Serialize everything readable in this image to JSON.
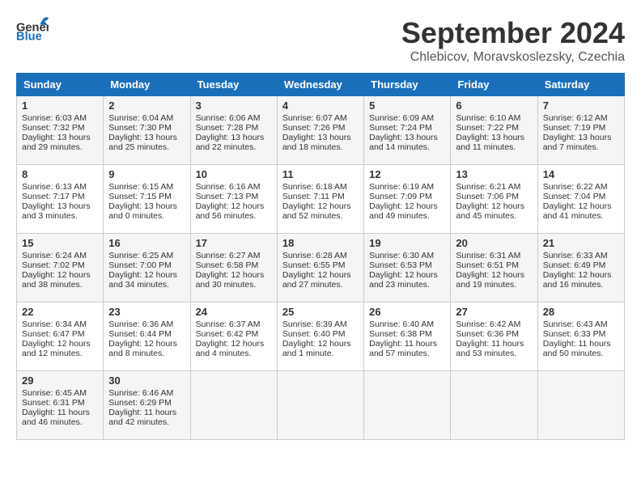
{
  "header": {
    "logo_general": "General",
    "logo_blue": "Blue",
    "month_title": "September 2024",
    "subtitle": "Chlebicov, Moravskoslezsky, Czechia"
  },
  "days_of_week": [
    "Sunday",
    "Monday",
    "Tuesday",
    "Wednesday",
    "Thursday",
    "Friday",
    "Saturday"
  ],
  "weeks": [
    [
      {
        "day": "1",
        "info": "Sunrise: 6:03 AM\nSunset: 7:32 PM\nDaylight: 13 hours\nand 29 minutes."
      },
      {
        "day": "2",
        "info": "Sunrise: 6:04 AM\nSunset: 7:30 PM\nDaylight: 13 hours\nand 25 minutes."
      },
      {
        "day": "3",
        "info": "Sunrise: 6:06 AM\nSunset: 7:28 PM\nDaylight: 13 hours\nand 22 minutes."
      },
      {
        "day": "4",
        "info": "Sunrise: 6:07 AM\nSunset: 7:26 PM\nDaylight: 13 hours\nand 18 minutes."
      },
      {
        "day": "5",
        "info": "Sunrise: 6:09 AM\nSunset: 7:24 PM\nDaylight: 13 hours\nand 14 minutes."
      },
      {
        "day": "6",
        "info": "Sunrise: 6:10 AM\nSunset: 7:22 PM\nDaylight: 13 hours\nand 11 minutes."
      },
      {
        "day": "7",
        "info": "Sunrise: 6:12 AM\nSunset: 7:19 PM\nDaylight: 13 hours\nand 7 minutes."
      }
    ],
    [
      {
        "day": "8",
        "info": "Sunrise: 6:13 AM\nSunset: 7:17 PM\nDaylight: 13 hours\nand 3 minutes."
      },
      {
        "day": "9",
        "info": "Sunrise: 6:15 AM\nSunset: 7:15 PM\nDaylight: 13 hours\nand 0 minutes."
      },
      {
        "day": "10",
        "info": "Sunrise: 6:16 AM\nSunset: 7:13 PM\nDaylight: 12 hours\nand 56 minutes."
      },
      {
        "day": "11",
        "info": "Sunrise: 6:18 AM\nSunset: 7:11 PM\nDaylight: 12 hours\nand 52 minutes."
      },
      {
        "day": "12",
        "info": "Sunrise: 6:19 AM\nSunset: 7:09 PM\nDaylight: 12 hours\nand 49 minutes."
      },
      {
        "day": "13",
        "info": "Sunrise: 6:21 AM\nSunset: 7:06 PM\nDaylight: 12 hours\nand 45 minutes."
      },
      {
        "day": "14",
        "info": "Sunrise: 6:22 AM\nSunset: 7:04 PM\nDaylight: 12 hours\nand 41 minutes."
      }
    ],
    [
      {
        "day": "15",
        "info": "Sunrise: 6:24 AM\nSunset: 7:02 PM\nDaylight: 12 hours\nand 38 minutes."
      },
      {
        "day": "16",
        "info": "Sunrise: 6:25 AM\nSunset: 7:00 PM\nDaylight: 12 hours\nand 34 minutes."
      },
      {
        "day": "17",
        "info": "Sunrise: 6:27 AM\nSunset: 6:58 PM\nDaylight: 12 hours\nand 30 minutes."
      },
      {
        "day": "18",
        "info": "Sunrise: 6:28 AM\nSunset: 6:55 PM\nDaylight: 12 hours\nand 27 minutes."
      },
      {
        "day": "19",
        "info": "Sunrise: 6:30 AM\nSunset: 6:53 PM\nDaylight: 12 hours\nand 23 minutes."
      },
      {
        "day": "20",
        "info": "Sunrise: 6:31 AM\nSunset: 6:51 PM\nDaylight: 12 hours\nand 19 minutes."
      },
      {
        "day": "21",
        "info": "Sunrise: 6:33 AM\nSunset: 6:49 PM\nDaylight: 12 hours\nand 16 minutes."
      }
    ],
    [
      {
        "day": "22",
        "info": "Sunrise: 6:34 AM\nSunset: 6:47 PM\nDaylight: 12 hours\nand 12 minutes."
      },
      {
        "day": "23",
        "info": "Sunrise: 6:36 AM\nSunset: 6:44 PM\nDaylight: 12 hours\nand 8 minutes."
      },
      {
        "day": "24",
        "info": "Sunrise: 6:37 AM\nSunset: 6:42 PM\nDaylight: 12 hours\nand 4 minutes."
      },
      {
        "day": "25",
        "info": "Sunrise: 6:39 AM\nSunset: 6:40 PM\nDaylight: 12 hours\nand 1 minute."
      },
      {
        "day": "26",
        "info": "Sunrise: 6:40 AM\nSunset: 6:38 PM\nDaylight: 11 hours\nand 57 minutes."
      },
      {
        "day": "27",
        "info": "Sunrise: 6:42 AM\nSunset: 6:36 PM\nDaylight: 11 hours\nand 53 minutes."
      },
      {
        "day": "28",
        "info": "Sunrise: 6:43 AM\nSunset: 6:33 PM\nDaylight: 11 hours\nand 50 minutes."
      }
    ],
    [
      {
        "day": "29",
        "info": "Sunrise: 6:45 AM\nSunset: 6:31 PM\nDaylight: 11 hours\nand 46 minutes."
      },
      {
        "day": "30",
        "info": "Sunrise: 6:46 AM\nSunset: 6:29 PM\nDaylight: 11 hours\nand 42 minutes."
      },
      {
        "day": "",
        "info": ""
      },
      {
        "day": "",
        "info": ""
      },
      {
        "day": "",
        "info": ""
      },
      {
        "day": "",
        "info": ""
      },
      {
        "day": "",
        "info": ""
      }
    ]
  ]
}
